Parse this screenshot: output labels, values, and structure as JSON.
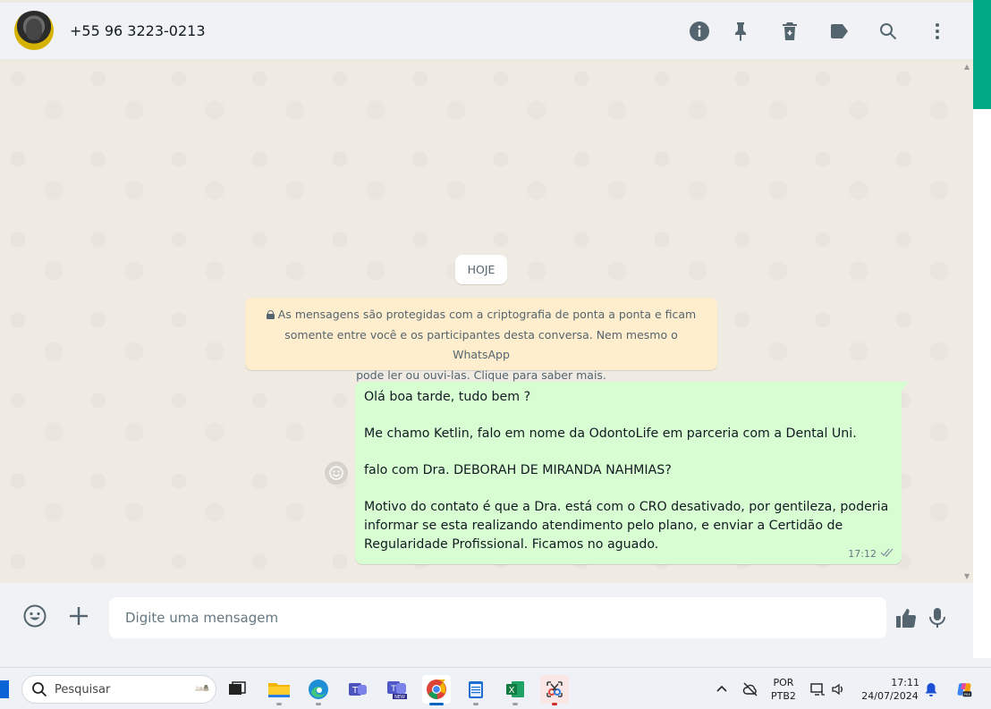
{
  "header": {
    "contact_name": "+55 96 3223-0213",
    "icons": [
      "info-icon",
      "pin-icon",
      "delete-icon",
      "label-icon",
      "search-icon",
      "menu-icon"
    ]
  },
  "chat": {
    "date_chip": "HOJE",
    "encryption_notice": {
      "line1": "As mensagens são protegidas com a criptografia de ponta a ponta e ficam",
      "line2": "somente entre você e os participantes desta conversa. Nem mesmo o WhatsApp",
      "line3": "pode ler ou ouvi-las. Clique para saber mais."
    },
    "message": {
      "lines": [
        "Olá boa tarde, tudo bem ?",
        "Me chamo Ketlin, falo em nome da OdontoLife em parceria com a Dental Uni.",
        "falo com Dra. DEBORAH DE MIRANDA NAHMIAS?",
        "Motivo do contato é que a Dra. está com o CRO desativado, por gentileza, poderia",
        "informar se esta realizando atendimento pelo plano, e enviar a Certidão de",
        "Regularidade Profissional. Ficamos no aguado."
      ],
      "time": "17:12",
      "status": "delivered"
    }
  },
  "composer": {
    "placeholder": "Digite uma mensagem",
    "value": ""
  },
  "taskbar": {
    "search_label": "Pesquisar",
    "lang_top": "POR",
    "lang_bottom": "PTB2",
    "time": "17:11",
    "date": "24/07/2024"
  },
  "colors": {
    "brand": "#00a884",
    "bubble_out": "#d9fdd3",
    "notice_bg": "#ffeecd",
    "chat_bg": "#efeae2",
    "icon_gray": "#54656f"
  }
}
